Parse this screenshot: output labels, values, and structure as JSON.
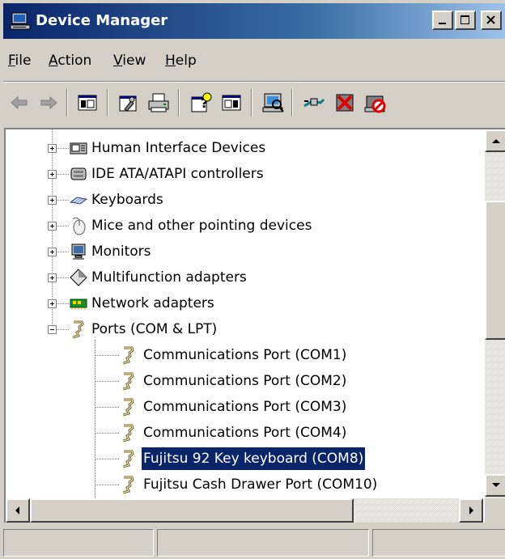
{
  "window": {
    "title": "Device Manager",
    "title_icon": "computer-icon",
    "controls": [
      "minimize-icon",
      "maximize-icon",
      "close-icon"
    ]
  },
  "menu": [
    {
      "mnemonic": "F",
      "rest": "ile"
    },
    {
      "mnemonic": "A",
      "rest": "ction"
    },
    {
      "mnemonic": "V",
      "rest": "iew"
    },
    {
      "mnemonic": "H",
      "rest": "elp"
    }
  ],
  "toolbar": {
    "icons": [
      "back-arrow-icon",
      "forward-arrow-icon",
      "show-hide-console-tree-icon",
      "properties-icon",
      "print-icon",
      "help-icon",
      "show-hide-action-pane-icon",
      "scan-hardware-changes-icon",
      "update-driver-icon",
      "uninstall-icon",
      "disable-device-icon"
    ]
  },
  "tree": {
    "items": [
      {
        "label": "Human Interface Devices",
        "icon": "hid-icon",
        "state": "collapsed"
      },
      {
        "label": "IDE ATA/ATAPI controllers",
        "icon": "ide-controller-icon",
        "state": "collapsed"
      },
      {
        "label": "Keyboards",
        "icon": "keyboard-icon",
        "state": "collapsed"
      },
      {
        "label": "Mice and other pointing devices",
        "icon": "mouse-icon",
        "state": "collapsed"
      },
      {
        "label": "Monitors",
        "icon": "monitor-icon",
        "state": "collapsed"
      },
      {
        "label": "Multifunction adapters",
        "icon": "multifunction-adapter-icon",
        "state": "collapsed"
      },
      {
        "label": "Network adapters",
        "icon": "network-adapter-icon",
        "state": "collapsed"
      },
      {
        "label": "Ports (COM & LPT)",
        "icon": "port-icon",
        "state": "expanded"
      },
      {
        "label": "Communications Port (COM1)",
        "icon": "port-icon",
        "state": "child"
      },
      {
        "label": "Communications Port (COM2)",
        "icon": "port-icon",
        "state": "child"
      },
      {
        "label": "Communications Port (COM3)",
        "icon": "port-icon",
        "state": "child"
      },
      {
        "label": "Communications Port (COM4)",
        "icon": "port-icon",
        "state": "child"
      },
      {
        "label": "Fujitsu 92 Key keyboard (COM8)",
        "icon": "port-icon",
        "state": "child-selected"
      },
      {
        "label": "Fujitsu Cash Drawer Port (COM10)",
        "icon": "port-icon",
        "state": "child"
      }
    ]
  },
  "colors": {
    "titlebar_start": "#0a246a",
    "titlebar_end": "#a6caf0",
    "selection": "#0a246a",
    "chrome": "#d4d0c8"
  }
}
